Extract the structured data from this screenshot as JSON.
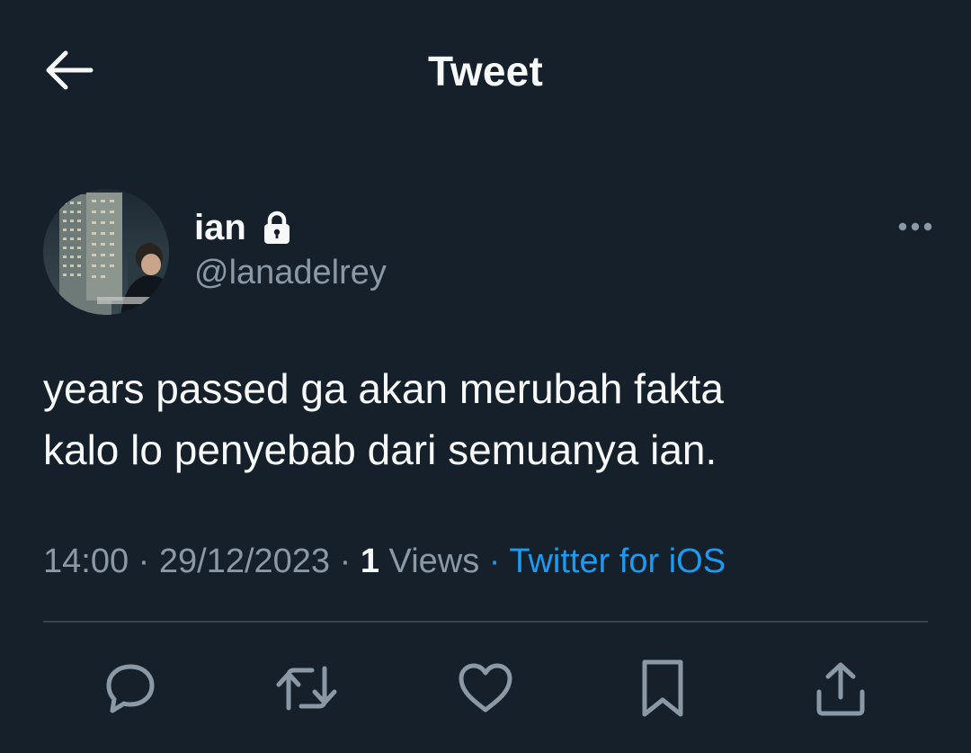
{
  "header": {
    "title": "Tweet",
    "back_icon": "arrow-left-icon"
  },
  "author": {
    "display_name": "ian",
    "protected_icon": "lock-icon",
    "handle": "@lanadelrey",
    "more_icon": "more-horizontal-icon"
  },
  "tweet": {
    "text": "years passed ga akan merubah fakta\nkalo lo penyebab dari semuanya ian."
  },
  "meta": {
    "time": "14:00",
    "date": "29/12/2023",
    "views_count": "1",
    "views_label": "Views",
    "source": "Twitter for iOS",
    "separator": "·"
  },
  "actions": [
    {
      "name": "reply",
      "icon": "reply-icon"
    },
    {
      "name": "retweet",
      "icon": "retweet-icon"
    },
    {
      "name": "like",
      "icon": "heart-icon"
    },
    {
      "name": "bookmark",
      "icon": "bookmark-icon"
    },
    {
      "name": "share",
      "icon": "share-icon"
    }
  ],
  "colors": {
    "background": "#15202b",
    "text_primary": "#f7f9f9",
    "text_secondary": "#8b98a5",
    "accent": "#1d9bf0",
    "divider": "#38444d"
  }
}
